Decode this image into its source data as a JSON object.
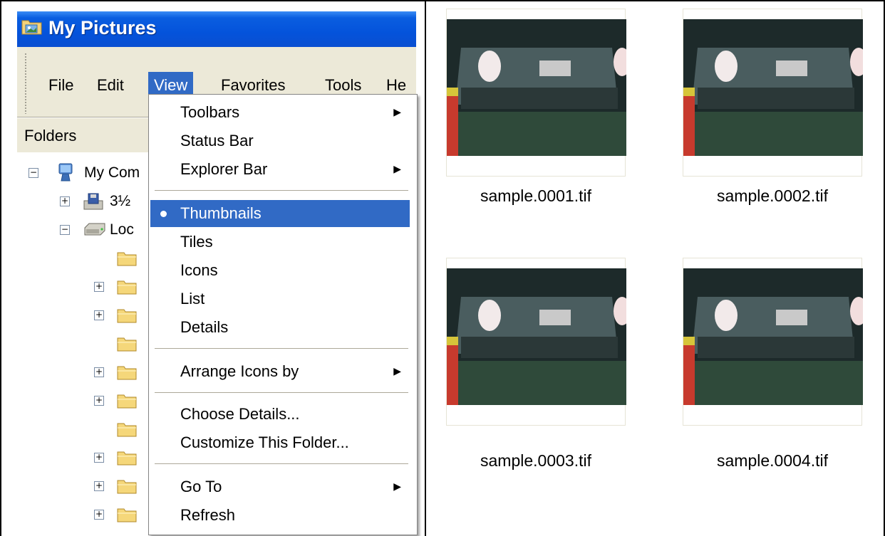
{
  "window": {
    "title": "My Pictures"
  },
  "menubar": {
    "items": [
      {
        "label": "File",
        "active": false
      },
      {
        "label": "Edit",
        "active": false
      },
      {
        "label": "View",
        "active": true
      },
      {
        "label": "Favorites",
        "active": false
      },
      {
        "label": "Tools",
        "active": false
      },
      {
        "label": "He",
        "active": false
      }
    ]
  },
  "folders_pane": {
    "title": "Folders",
    "tree": [
      {
        "label": "My Com",
        "icon": "my-computer-icon",
        "expander": "−"
      },
      {
        "label": "3½",
        "icon": "floppy-drive-icon",
        "expander": "+"
      },
      {
        "label": "Loc",
        "icon": "hard-drive-icon",
        "expander": "−"
      }
    ]
  },
  "view_menu": {
    "items": [
      {
        "label": "Toolbars",
        "submenu": true
      },
      {
        "label": "Status Bar",
        "submenu": false
      },
      {
        "label": "Explorer Bar",
        "submenu": true
      },
      {
        "label": "Thumbnails",
        "submenu": false,
        "selected": true,
        "checked": true
      },
      {
        "label": "Tiles",
        "submenu": false
      },
      {
        "label": "Icons",
        "submenu": false
      },
      {
        "label": "List",
        "submenu": false
      },
      {
        "label": "Details",
        "submenu": false
      },
      {
        "label": "Arrange Icons by",
        "submenu": true
      },
      {
        "label": "Choose Details...",
        "submenu": false
      },
      {
        "label": "Customize This Folder...",
        "submenu": false
      },
      {
        "label": "Go To",
        "submenu": true
      },
      {
        "label": "Refresh",
        "submenu": false
      }
    ]
  },
  "thumbnails": [
    {
      "filename": "sample.0001.tif"
    },
    {
      "filename": "sample.0002.tif"
    },
    {
      "filename": "sample.0003.tif"
    },
    {
      "filename": "sample.0004.tif"
    }
  ],
  "colors": {
    "titlebar": "#0a5ee0",
    "menu_highlight": "#316ac5",
    "chrome": "#ece9d8"
  }
}
